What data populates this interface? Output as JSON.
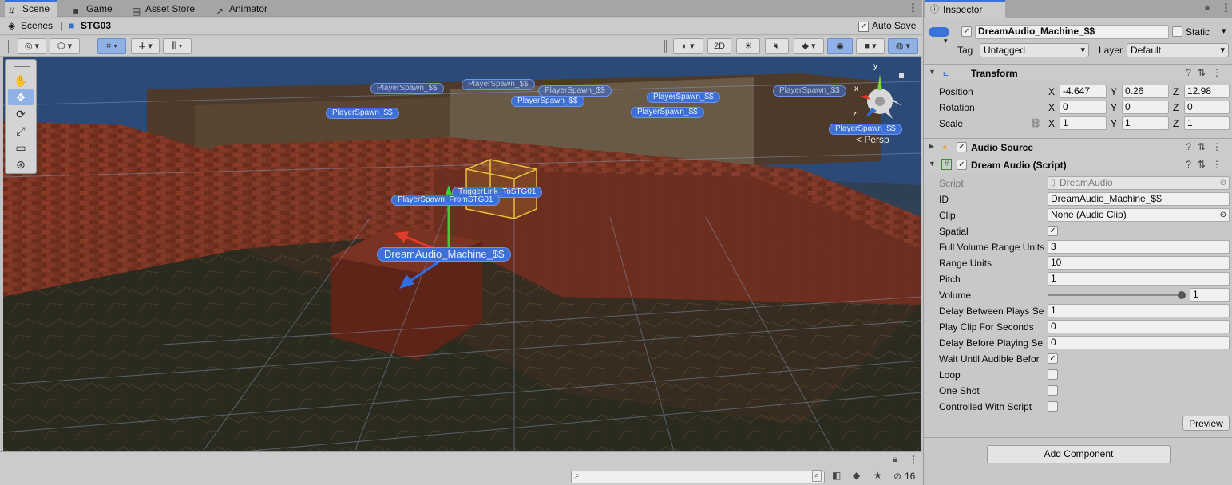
{
  "scene_window": {
    "tabs": [
      {
        "label": "Scene",
        "icon": "grid-icon"
      },
      {
        "label": "Game",
        "icon": "gamepad-icon"
      },
      {
        "label": "Asset Store",
        "icon": "store-icon"
      },
      {
        "label": "Animator",
        "icon": "animator-icon"
      }
    ],
    "breadcrumb": {
      "root": "Scenes",
      "current": "STG03"
    },
    "auto_save_label": "Auto Save",
    "toolbar": {
      "mode_2d": "2D"
    },
    "persp_label": "< Persp",
    "hidden_count": "16",
    "viewport_tags": {
      "main": "DreamAudio_Machine_$$",
      "trigger": "TriggerLink_ToSTG01",
      "spawn_from": "PlayerSpawn_FromSTG01",
      "spawn_generic": "PlayerSpawn_$$"
    },
    "gizmo": {
      "y": "y",
      "x": "x",
      "z": "z"
    }
  },
  "inspector": {
    "tab_label": "Inspector",
    "object_name": "DreamAudio_Machine_$$",
    "static_label": "Static",
    "tag_label": "Tag",
    "tag_value": "Untagged",
    "layer_label": "Layer",
    "layer_value": "Default",
    "transform": {
      "title": "Transform",
      "position_label": "Position",
      "rotation_label": "Rotation",
      "scale_label": "Scale",
      "position": {
        "x": "-4.647",
        "y": "0.26",
        "z": "12.98"
      },
      "rotation": {
        "x": "0",
        "y": "0",
        "z": "0"
      },
      "scale": {
        "x": "1",
        "y": "1",
        "z": "1"
      }
    },
    "audio_source": {
      "title": "Audio Source"
    },
    "dream_audio": {
      "title": "Dream Audio (Script)",
      "script_label": "Script",
      "script_value": "DreamAudio",
      "id_label": "ID",
      "id_value": "DreamAudio_Machine_$$",
      "clip_label": "Clip",
      "clip_value": "None (Audio Clip)",
      "spatial_label": "Spatial",
      "full_volume_label": "Full Volume Range Units",
      "full_volume_value": "3",
      "range_units_label": "Range Units",
      "range_units_value": "10",
      "pitch_label": "Pitch",
      "pitch_value": "1",
      "volume_label": "Volume",
      "volume_value": "1",
      "volume_fraction": 1.0,
      "delay_between_label": "Delay Between Plays Se",
      "delay_between_value": "1",
      "play_clip_label": "Play Clip For Seconds",
      "play_clip_value": "0",
      "delay_before_label": "Delay Before Playing Se",
      "delay_before_value": "0",
      "wait_until_label": "Wait Until Audible Befor",
      "loop_label": "Loop",
      "one_shot_label": "One Shot",
      "controlled_label": "Controlled With Script",
      "preview_label": "Preview"
    },
    "add_component_label": "Add Component"
  },
  "colors": {
    "accent": "#3a72d8",
    "selection": "#8fb1e6",
    "tag_blue": "#3d6fd6"
  }
}
